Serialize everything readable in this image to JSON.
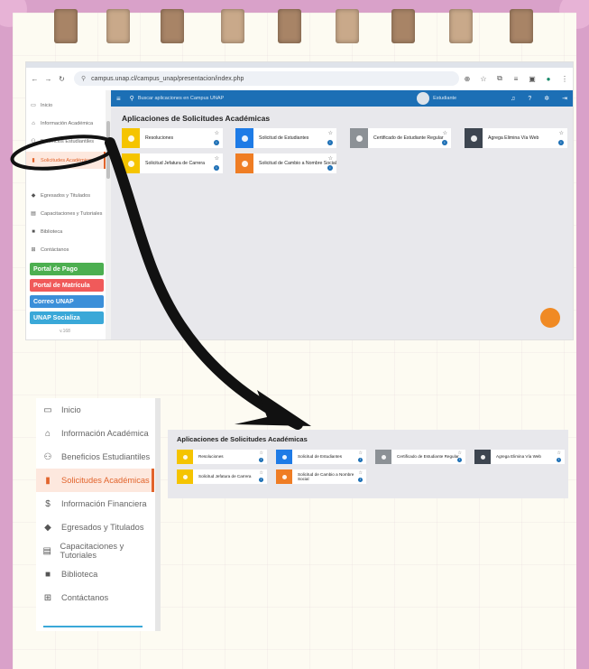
{
  "browser": {
    "url": "campus.unap.cl/campus_unap/presentacion/index.php"
  },
  "topbar": {
    "search_placeholder": "Buscar aplicaciones en Campus UNAP",
    "user_label": "Estudiante"
  },
  "sidebar": {
    "items": [
      {
        "label": "Inicio",
        "icon": "id-card-icon"
      },
      {
        "label": "Información Académica",
        "icon": "institution-icon"
      },
      {
        "label": "Beneficios Estudiantiles",
        "icon": "users-icon"
      },
      {
        "label": "Solicitudes Académicas",
        "icon": "document-icon"
      },
      {
        "label": "Información Financiera",
        "icon": "dollar-icon"
      },
      {
        "label": "Egresados y Titulados",
        "icon": "graduation-cap-icon"
      },
      {
        "label": "Capacitaciones y Tutoriales",
        "icon": "book-icon"
      },
      {
        "label": "Biblioteca",
        "icon": "library-icon"
      },
      {
        "label": "Contáctanos",
        "icon": "sitemap-icon"
      }
    ],
    "portals": [
      {
        "label": "Portal de Pago",
        "color": "#4caf50"
      },
      {
        "label": "Portal de Matrícula",
        "color": "#f05a5a"
      },
      {
        "label": "Correo UNAP",
        "color": "#3b8fd9"
      },
      {
        "label": "UNAP Socializa",
        "color": "#3aa8d8"
      }
    ],
    "version": "v.168"
  },
  "main": {
    "section_title": "Aplicaciones de Solicitudes Académicas",
    "cards": [
      {
        "label": "Resoluciones",
        "color": "#f5c400"
      },
      {
        "label": "Solicitud de Estudiantes",
        "color": "#1e7be6"
      },
      {
        "label": "Certificado de Estudiante Regular",
        "color": "#8c9196"
      },
      {
        "label": "Agrega Elimina Vía Web",
        "color": "#3d4550"
      },
      {
        "label": "Solicitud Jefatura de Carrera",
        "color": "#f5c400"
      },
      {
        "label": "Solicitud de Cambio a Nombre Social",
        "color": "#ef7d24"
      }
    ]
  },
  "annotation": {
    "active_item": "Solicitudes Académicas",
    "arrow_color": "#111111"
  }
}
